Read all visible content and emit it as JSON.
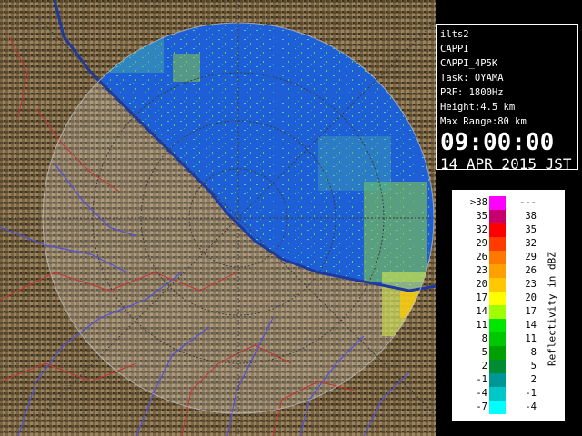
{
  "info": {
    "site": "ilts2",
    "product": "CAPPI",
    "product_code": "CAPPI_4P5K",
    "task": "Task: OYAMA",
    "prf": "PRF: 1800Hz",
    "height": "Height:4.5 km",
    "max_range": "Max Range:80 km",
    "time": "09:00:00",
    "date": "14 APR 2015 JST"
  },
  "legend": {
    "unit": "Reflectivity in dBZ",
    "rows": [
      {
        "lo": ">38",
        "hi": "---",
        "color": "#ff00ff"
      },
      {
        "lo": "35",
        "hi": "38",
        "color": "#c8006e"
      },
      {
        "lo": "32",
        "hi": "35",
        "color": "#ff0000"
      },
      {
        "lo": "29",
        "hi": "32",
        "color": "#ff3c00"
      },
      {
        "lo": "26",
        "hi": "29",
        "color": "#ff7800"
      },
      {
        "lo": "23",
        "hi": "26",
        "color": "#ffa000"
      },
      {
        "lo": "20",
        "hi": "23",
        "color": "#ffc800"
      },
      {
        "lo": "17",
        "hi": "20",
        "color": "#ffff00"
      },
      {
        "lo": "14",
        "hi": "17",
        "color": "#a0ff00"
      },
      {
        "lo": "11",
        "hi": "14",
        "color": "#00e600"
      },
      {
        "lo": "8",
        "hi": "11",
        "color": "#00c800"
      },
      {
        "lo": "5",
        "hi": "8",
        "color": "#00a000"
      },
      {
        "lo": "2",
        "hi": "5",
        "color": "#008c32"
      },
      {
        "lo": "-1",
        "hi": "2",
        "color": "#009696"
      },
      {
        "lo": "-4",
        "hi": "-1",
        "color": "#00c8c8"
      },
      {
        "lo": "-7",
        "hi": "-4",
        "color": "#00ffff"
      }
    ]
  },
  "colors": {
    "sea": "#1e5fd8",
    "land": "#7a6545",
    "coast": "#1e3aa0",
    "rivers": "#5050e0",
    "boundaries": "#c83232"
  }
}
